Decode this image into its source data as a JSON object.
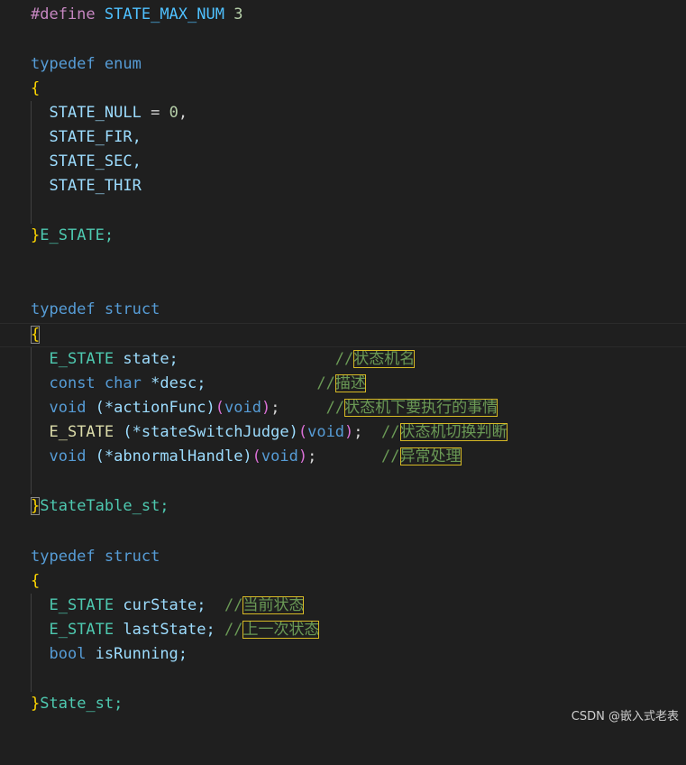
{
  "code": {
    "define_kw": "#define",
    "define_name": "STATE_MAX_NUM",
    "define_value": "3",
    "typedef": "typedef",
    "enum": "enum",
    "struct": "struct",
    "open_brace": "{",
    "close_brace": "}",
    "enum_members": [
      "STATE_NULL",
      "STATE_FIR,",
      "STATE_SEC,",
      "STATE_THIR"
    ],
    "enum_null_eq": " = ",
    "enum_null_val": "0",
    "enum_null_comma": ",",
    "enum_name": "E_STATE;",
    "st1": {
      "l1_type": "E_STATE",
      "l1_rest": " state;",
      "l1_pad": "                 ",
      "l2_const": "const",
      "l2_char": "char",
      "l2_rest": " *desc;",
      "l2_pad": "            ",
      "l3_void": "void",
      "l3_mid": " (*actionFunc)",
      "l3_pl": "(",
      "l3_void2": "void",
      "l3_pr": ")",
      "l3_end": ";",
      "l3_pad": "     ",
      "l4_type": "E_STATE",
      "l4_mid": " (*stateSwitchJudge)",
      "l4_pl": "(",
      "l4_void": "void",
      "l4_pr": ")",
      "l4_end": ";",
      "l4_pad": "  ",
      "l5_void": "void",
      "l5_mid": " (*abnormalHandle)",
      "l5_pl": "(",
      "l5_void2": "void",
      "l5_pr": ")",
      "l5_end": ";",
      "l5_pad": "       ",
      "name": "StateTable_st;"
    },
    "st2": {
      "l1_type": "E_STATE",
      "l1_rest": " curState;",
      "l1_pad": "  ",
      "l2_type": "E_STATE",
      "l2_rest": " lastState;",
      "l2_pad": " ",
      "l3_bool": "bool",
      "l3_rest": " isRunning;",
      "name": "State_st;"
    },
    "comment_prefix": "//",
    "comments": {
      "c1": "状态机名",
      "c2": "描述",
      "c3": "状态机下要执行的事情",
      "c4": "状态机切换判断",
      "c5": "异常处理",
      "c6": "当前状态",
      "c7": "上一次状态"
    }
  },
  "watermark": "CSDN @嵌入式老表",
  "colors": {
    "background": "#1f1f1f",
    "keyword": "#569cd6",
    "preprocessor": "#c586c0",
    "bracket": "#ffd700",
    "comment": "#6a9955",
    "highlight_border": "#d7ba25"
  }
}
